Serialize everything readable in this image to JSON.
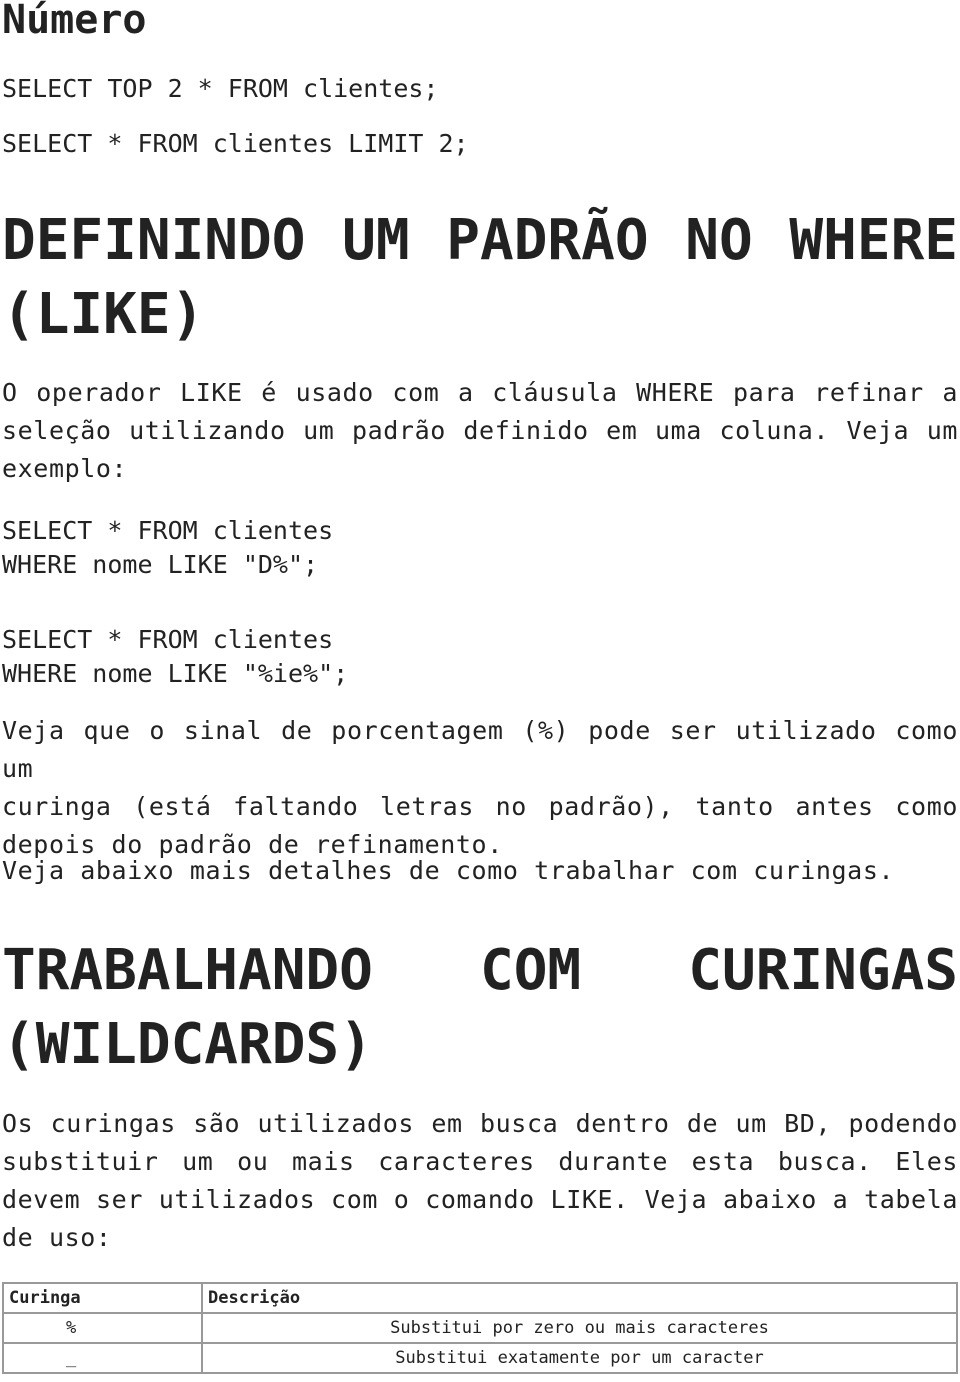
{
  "title": "Número",
  "top_examples": [
    "SELECT TOP 2 * FROM clientes;",
    "SELECT * FROM clientes LIMIT 2;"
  ],
  "section_like": {
    "heading_line1": "DEFININDO UM PADRÃO NO WHERE",
    "heading_line2": "(LIKE)",
    "intro_lines": [
      "O operador LIKE é usado com a cláusula WHERE para refinar a",
      "seleção utilizando um padrão definido em uma coluna. Veja um",
      "exemplo:"
    ],
    "example1": [
      "SELECT * FROM clientes",
      "WHERE nome LIKE \"D%\";"
    ],
    "example2": [
      "SELECT * FROM clientes",
      "WHERE nome LIKE \"%ie%\";"
    ],
    "note_lines": [
      "Veja que o sinal de porcentagem (%) pode ser utilizado como um",
      "curinga (está faltando letras no padrão), tanto antes como",
      "depois do padrão de refinamento."
    ],
    "see_below": "Veja abaixo mais detalhes de como trabalhar com curingas."
  },
  "section_wildcards": {
    "heading_line1": "TRABALHANDO COM CURINGAS",
    "heading_line2": "(WILDCARDS)",
    "intro_lines": [
      "Os curingas são utilizados em busca dentro de um BD, podendo",
      "substituir um ou mais caracteres durante esta busca. Eles",
      "devem ser utilizados com o comando LIKE. Veja abaixo a tabela",
      "de uso:"
    ],
    "table": {
      "headers": [
        "Curinga",
        "Descrição"
      ],
      "rows": [
        [
          "%",
          "Substitui por zero ou mais caracteres"
        ],
        [
          "_",
          "Substitui exatamente por um caracter"
        ]
      ]
    }
  }
}
